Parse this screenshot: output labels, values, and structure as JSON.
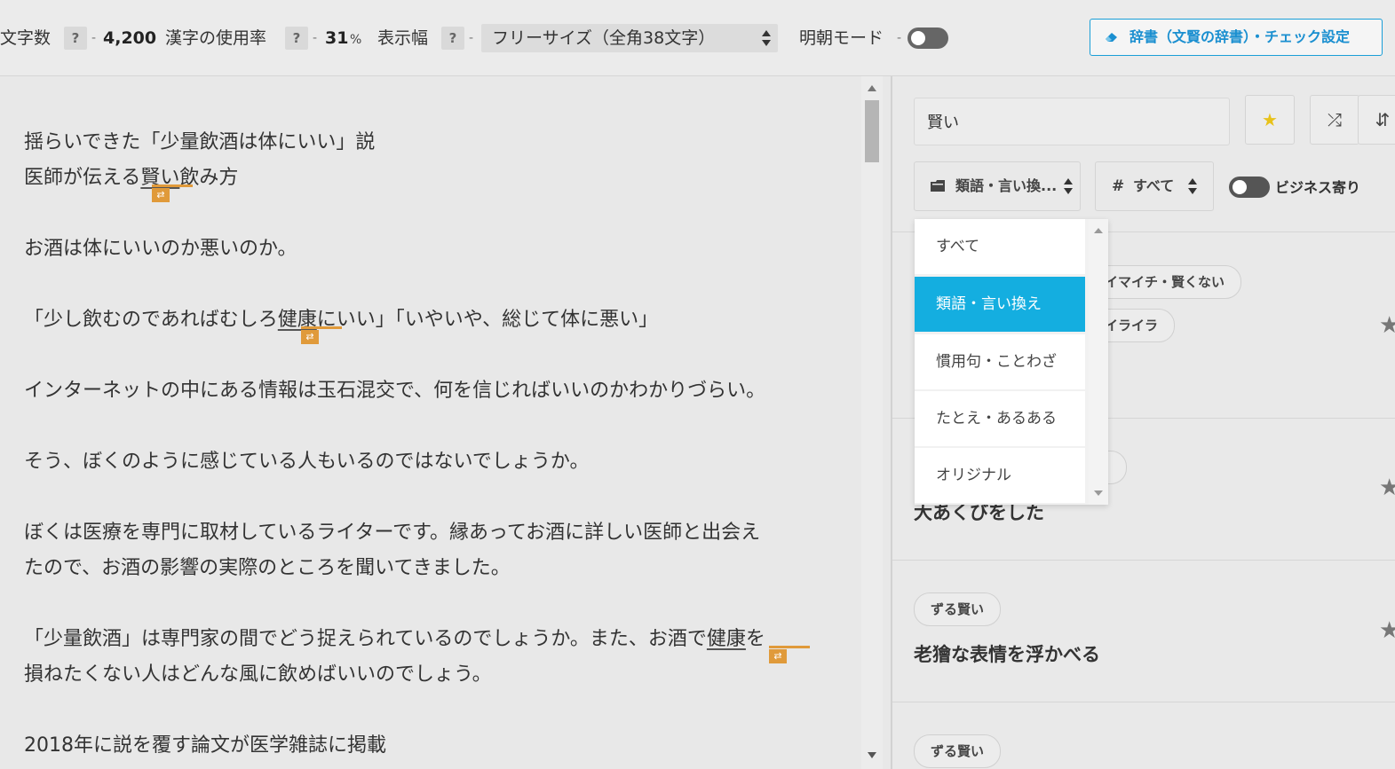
{
  "toolbar": {
    "char_count_label": "文字数",
    "char_count_value": "4,200",
    "kanji_label": "漢字の使用率",
    "kanji_value": "31",
    "kanji_unit": "%",
    "width_label": "表示幅",
    "width_selected": "フリーサイズ（全角38文字）",
    "mincho_label": "明朝モード",
    "help_mark": "?",
    "separator": "-",
    "dict_button": "辞書（文賢の辞書）・チェック設定"
  },
  "editor": {
    "lines": [
      "揺らいできた「少量飲酒は体にいい」説",
      "お酒は体にいいのか悪いのか。",
      "インターネットの中にある情報は玉石混交で、何を信じればいいのかわかりづらい。",
      "そう、ぼくのように感じている人もいるのではないでしょうか。",
      "ぼくは医療を専門に取材しているライターです。縁あってお酒に詳しい医師と出会え",
      "たので、お酒の影響の実際のところを聞いてきました。",
      "損ねたくない人はどんな風に飲めばいいのでしょう。",
      "2018年に説を覆す論文が医学雑誌に掲載"
    ],
    "line2_before": "医師が伝える",
    "line2_marked": "賢い",
    "line2_after": "飲み方",
    "line4_before": "「少し飲むのであればむしろ",
    "line4_marked": "健康",
    "line4_after": "にいい」「いやいや、総じて体に悪い」",
    "line9_before": "「少量飲酒」は専門家の間でどう捉えられているのでしょうか。また、お酒で",
    "line9_marked": "健康",
    "line9_after": "を",
    "marker_glyph": "⇄"
  },
  "panel": {
    "search_value": "賢い",
    "category_select": "類語・言い換...",
    "tag_select": "すべて",
    "business_label": "ビジネス寄り",
    "star_glyph": "★",
    "shuffle_glyph": "⤮",
    "sort_glyph": "⇵",
    "tag_visible_1": "イマイチ・賢くない",
    "tag_visible_2": "イライラ",
    "result_2_title": "大あくびをした",
    "result_3_tag": "ずる賢い",
    "result_3_title": "老獪な表情を浮かべる",
    "result_4_tag": "ずる賢い"
  },
  "dropdown": {
    "options": [
      "すべて",
      "類語・言い換え",
      "慣用句・ことわざ",
      "たとえ・あるある",
      "オリジナル"
    ],
    "selected_index": 1
  },
  "colors": {
    "accent": "#14aee0",
    "marker": "#e09a3a",
    "star": "#e8c21a"
  },
  "icons": {
    "dict_button_icon": "eraser-icon",
    "category_icon": "folder-icon",
    "tag_icon": "hash-icon"
  }
}
